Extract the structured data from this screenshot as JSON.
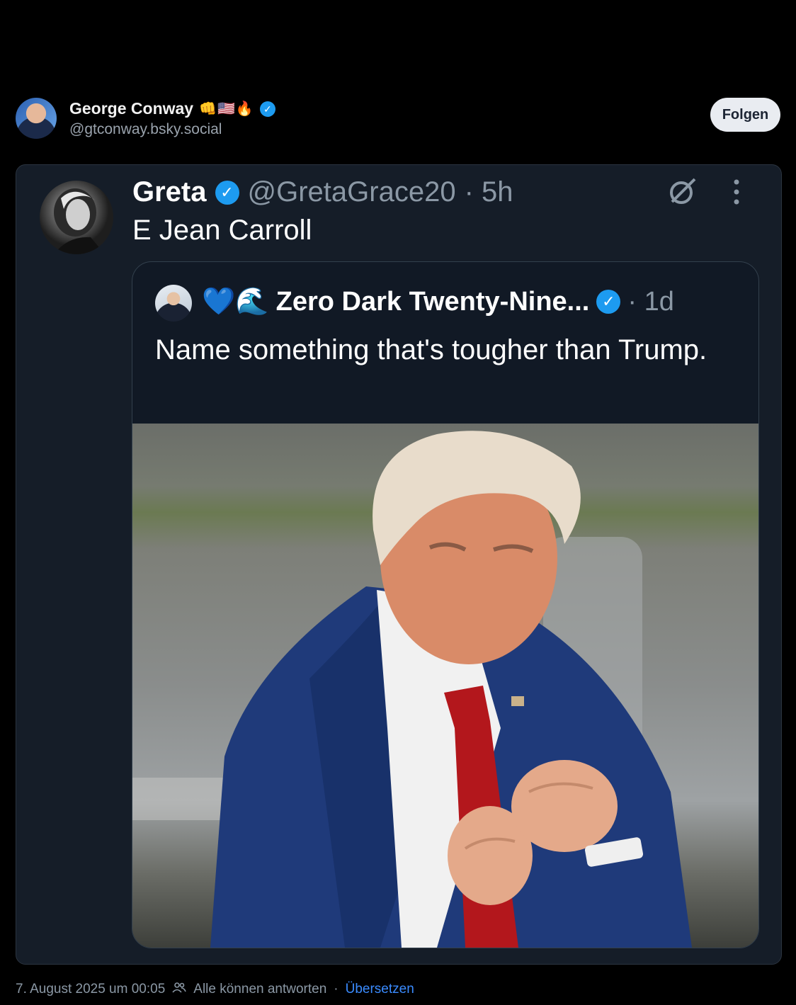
{
  "post": {
    "author_name": "George Conway",
    "author_emojis": "👊🇺🇸🔥",
    "author_handle": "@gtconway.bsky.social",
    "follow_label": "Folgen",
    "timestamp": "7. August 2025 um 00:05",
    "reply_setting": "Alle können antworten",
    "separator": "·",
    "translate_label": "Übersetzen"
  },
  "tweet": {
    "author_name": "Greta",
    "author_handle": "@GretaGrace20",
    "time": "· 5h",
    "text": "E Jean Carroll",
    "quoted": {
      "author_emojis": "💙🌊",
      "author_name": "Zero Dark Twenty-Nine...",
      "time": "· 1d",
      "text": "Name something that's tougher than Trump."
    }
  },
  "icons": {
    "verified": "verified-badge-icon",
    "grok": "grok-icon",
    "more": "more-options-icon",
    "people": "people-icon"
  },
  "colors": {
    "background": "#000000",
    "card": "#151d28",
    "verified": "#1d9bf0",
    "link": "#3a8bff"
  }
}
